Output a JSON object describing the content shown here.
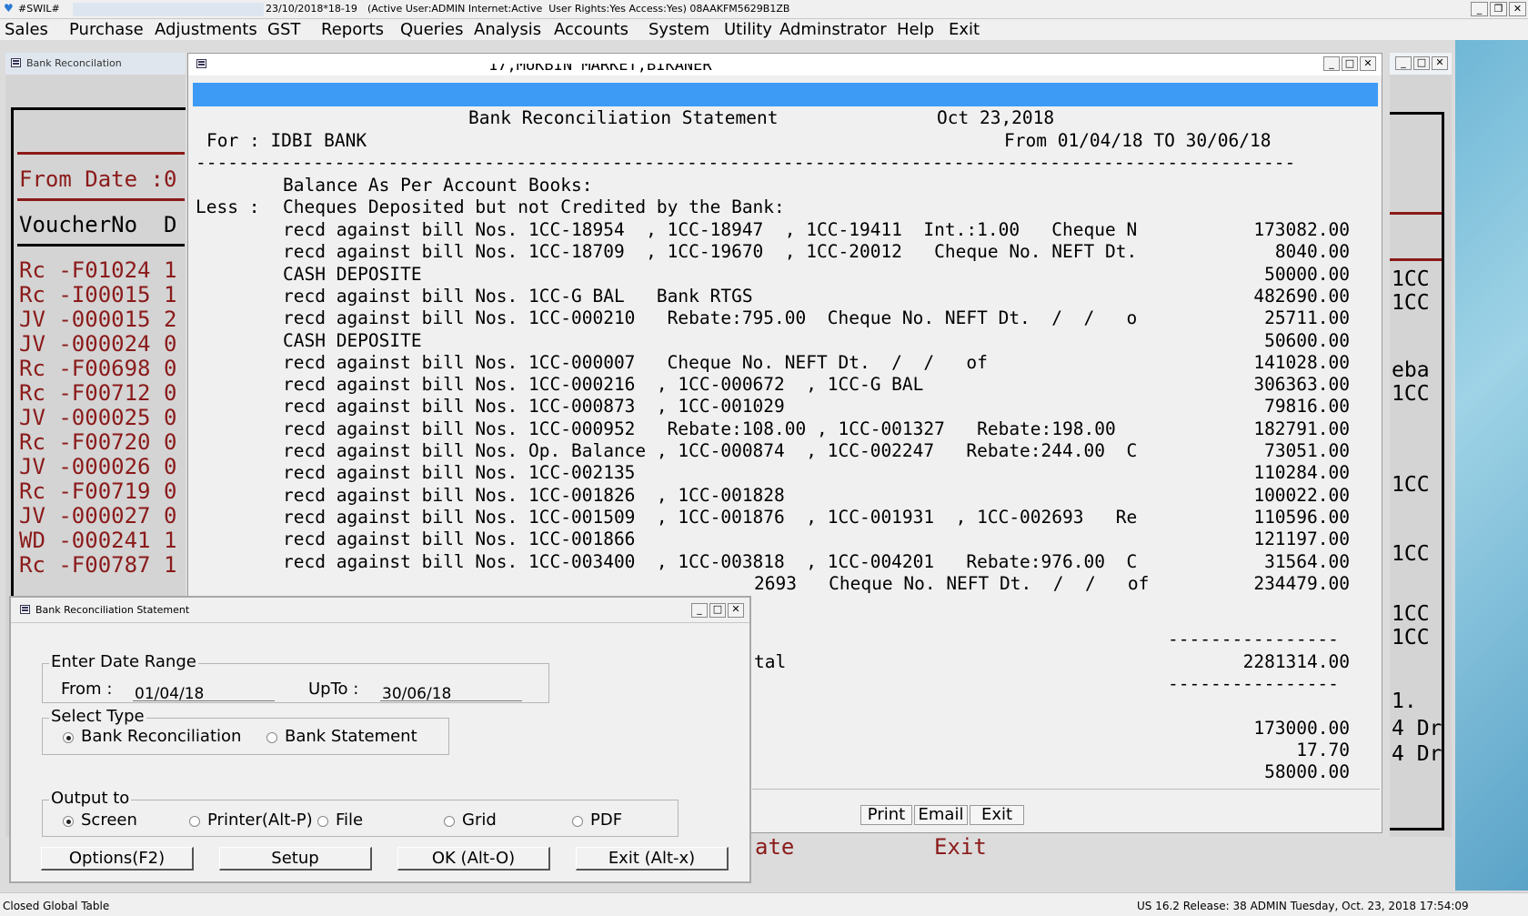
{
  "titlebar": {
    "app": "#SWIL#",
    "date_time": "23/10/2018*18-19",
    "session": "(Active User:ADMIN Internet:Active  User Rights:Yes Access:Yes) 08AAKFM5629B1ZB"
  },
  "menu": [
    "Sales",
    "Purchase",
    "Adjustments",
    "GST",
    "Reports",
    "Queries",
    "Analysis",
    "Accounts",
    "System",
    "Utility",
    "Adminstrator",
    "Help",
    "Exit"
  ],
  "left_window": {
    "title": "Bank Reconcilation",
    "from_date": "From Date :0",
    "header": "VoucherNo  D",
    "rows": [
      "Rc -F01024 1",
      "Rc -I00015 1",
      "JV -000015 2",
      "JV -000024 0",
      "Rc -F00698 0",
      "Rc -F00712 0",
      "JV -000025 0",
      "Rc -F00720 0",
      "JV -000026 0",
      "Rc -F00719 0",
      "JV -000027 0",
      "WD -000241 1",
      "Rc -F00787 1"
    ],
    "footer_fragments": [
      "ate",
      "Exit"
    ]
  },
  "right_window": {
    "fragments": [
      "1CC",
      "1CC",
      "eba",
      "1CC",
      "1CC",
      "1CC",
      "1CC",
      "1CC",
      "1.",
      "4 Dr",
      "4 Dr"
    ]
  },
  "report": {
    "cut_header": "17,MUKBIN MARKET,BIKANER",
    "title": "Bank Reconciliation Statement",
    "date": "Oct 23,2018",
    "for_label": "For : IDBI BANK",
    "period": "From 01/04/18 TO 30/06/18",
    "separator": "-------------------------------------------------------------------------------------------------------",
    "balance_label": "Balance As Per Account Books:",
    "less_label": "Less :",
    "less_desc": "Cheques Deposited but not Credited by the Bank:",
    "lines": [
      {
        "text": "recd against bill Nos. 1CC-18954  , 1CC-18947  , 1CC-19411  Int.:1.00   Cheque N",
        "amount": "173082.00"
      },
      {
        "text": "recd against bill Nos. 1CC-18709  , 1CC-19670  , 1CC-20012   Cheque No. NEFT Dt.",
        "amount": "8040.00"
      },
      {
        "text": "CASH DEPOSITE",
        "amount": "50000.00"
      },
      {
        "text": "recd against bill Nos. 1CC-G BAL   Bank RTGS",
        "amount": "482690.00"
      },
      {
        "text": "recd against bill Nos. 1CC-000210   Rebate:795.00  Cheque No. NEFT Dt.  /  /   o",
        "amount": "25711.00"
      },
      {
        "text": "CASH DEPOSITE",
        "amount": "50600.00"
      },
      {
        "text": "recd against bill Nos. 1CC-000007   Cheque No. NEFT Dt.  /  /   of",
        "amount": "141028.00"
      },
      {
        "text": "recd against bill Nos. 1CC-000216  , 1CC-000672  , 1CC-G BAL",
        "amount": "306363.00"
      },
      {
        "text": "recd against bill Nos. 1CC-000873  , 1CC-001029",
        "amount": "79816.00"
      },
      {
        "text": "recd against bill Nos. 1CC-000952   Rebate:108.00 , 1CC-001327   Rebate:198.00",
        "amount": "182791.00"
      },
      {
        "text": "recd against bill Nos. Op. Balance , 1CC-000874  , 1CC-002247   Rebate:244.00  C",
        "amount": "73051.00"
      },
      {
        "text": "recd against bill Nos. 1CC-002135",
        "amount": "110284.00"
      },
      {
        "text": "recd against bill Nos. 1CC-001826  , 1CC-001828",
        "amount": "100022.00"
      },
      {
        "text": "recd against bill Nos. 1CC-001509  , 1CC-001876  , 1CC-001931  , 1CC-002693   Re",
        "amount": "110596.00"
      },
      {
        "text": "recd against bill Nos. 1CC-001866",
        "amount": "121197.00"
      },
      {
        "text": "recd against bill Nos. 1CC-003400  , 1CC-003818  , 1CC-004201   Rebate:976.00  C",
        "amount": "31564.00"
      },
      {
        "text": "2693   Cheque No. NEFT Dt.  /  /   of",
        "amount": "234479.00"
      }
    ],
    "dash_line": "----------------",
    "total_label": "tal",
    "total": "2281314.00",
    "after_total": [
      "173000.00",
      "17.70",
      "58000.00"
    ],
    "buttons": [
      "Print",
      "Email",
      "Exit"
    ]
  },
  "dialog": {
    "title": "Bank Reconciliation Statement",
    "date_range_label": "Enter Date Range",
    "from_label": "From :",
    "from_value": "01/04/18",
    "upto_label": "UpTo :",
    "upto_value": "30/06/18",
    "select_type_label": "Select Type",
    "type_options": [
      "Bank Reconciliation",
      "Bank Statement"
    ],
    "type_selected": "Bank Reconciliation",
    "output_label": "Output to",
    "output_options": [
      "Screen",
      "Printer(Alt-P)",
      "File",
      "Grid",
      "PDF"
    ],
    "output_selected": "Screen",
    "buttons": [
      "Options(F2)",
      "Setup",
      "OK (Alt-O)",
      "Exit (Alt-x)"
    ]
  },
  "statusbar": {
    "left": "Closed Global Table",
    "right": "US 16.2 Release: 38 ADMIN  Tuesday, Oct. 23, 2018  17:54:09"
  }
}
